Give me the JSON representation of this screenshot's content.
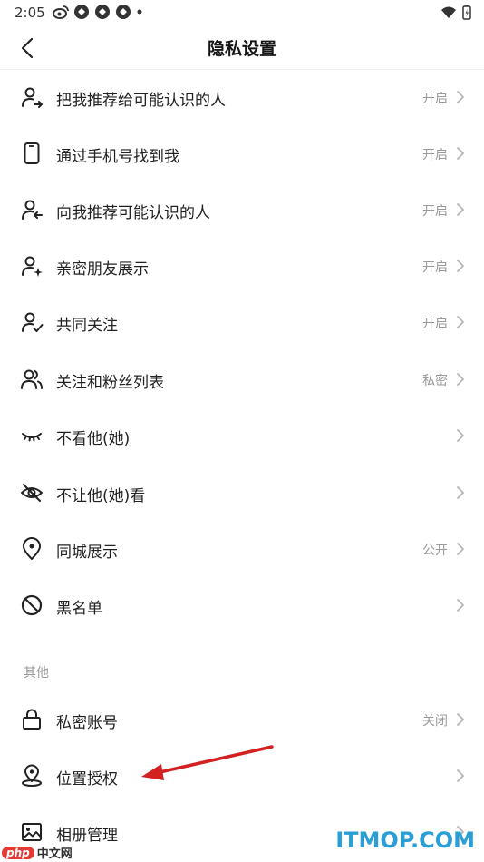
{
  "status": {
    "time": "2:05"
  },
  "header": {
    "title": "隐私设置"
  },
  "rows": [
    {
      "label": "把我推荐给可能认识的人",
      "value": "开启",
      "icon": "user-share-icon"
    },
    {
      "label": "通过手机号找到我",
      "value": "开启",
      "icon": "phone-icon"
    },
    {
      "label": "向我推荐可能认识的人",
      "value": "开启",
      "icon": "user-recommend-icon"
    },
    {
      "label": "亲密朋友展示",
      "value": "开启",
      "icon": "user-sparkle-icon"
    },
    {
      "label": "共同关注",
      "value": "开启",
      "icon": "user-check-icon"
    },
    {
      "label": "关注和粉丝列表",
      "value": "私密",
      "icon": "users-icon"
    },
    {
      "label": "不看他(她)",
      "value": "",
      "icon": "closed-eye-icon"
    },
    {
      "label": "不让他(她)看",
      "value": "",
      "icon": "eye-off-icon"
    },
    {
      "label": "同城展示",
      "value": "公开",
      "icon": "location-pin-icon"
    },
    {
      "label": "黑名单",
      "value": "",
      "icon": "block-icon"
    }
  ],
  "other": {
    "title": "其他",
    "rows": [
      {
        "label": "私密账号",
        "value": "关闭",
        "icon": "lock-icon"
      },
      {
        "label": "位置授权",
        "value": "",
        "icon": "location-auth-icon"
      },
      {
        "label": "相册管理",
        "value": "",
        "icon": "image-icon"
      }
    ]
  },
  "watermarks": {
    "left_badge": "php",
    "left_text": "中文网",
    "right_text": "ITMOP.COM"
  },
  "colors": {
    "arrow": "#d32020",
    "value_text": "#9a9a9a",
    "watermark_blue": "#2a9fd6"
  }
}
